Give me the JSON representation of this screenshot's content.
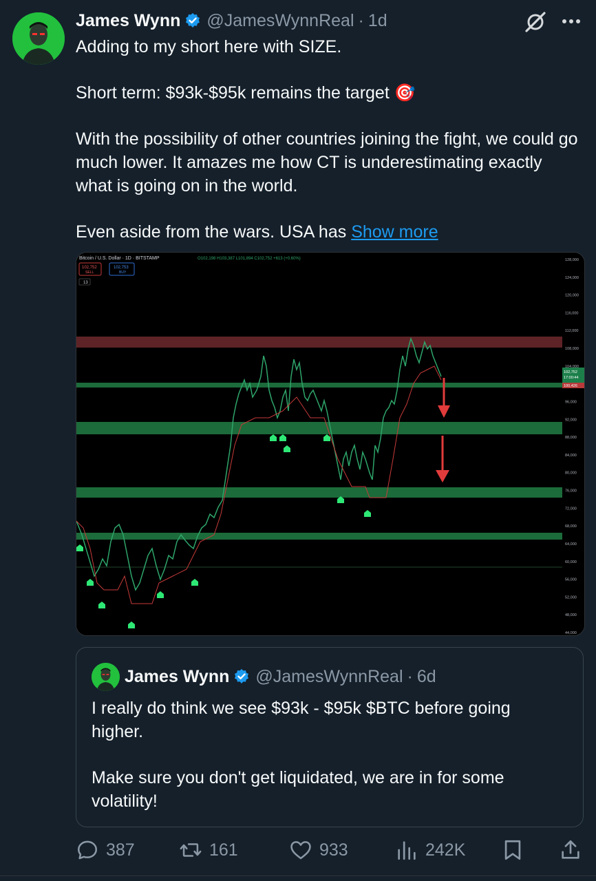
{
  "tweet": {
    "author_name": "James Wynn",
    "handle": "@JamesWynnReal",
    "separator": "·",
    "time": "1d",
    "text_lines": [
      "Adding to my short here with SIZE.",
      "Short term: $93k-$95k remains the target 🎯",
      "With the possibility of other countries joining the fight, we could go much lower. It amazes me how CT is underestimating exactly what is going on in the world.",
      "Even aside from the wars. USA has"
    ],
    "show_more": "Show more"
  },
  "chart": {
    "title": "Bitcoin / U.S. Dollar · 1D · BITSTAMP",
    "ohlc": "O102,198 H103,387 L101,894 C102,752 +613 (+0.60%)",
    "sell_price": "102,752",
    "sell_label": "SELL",
    "buy_price": "102,753",
    "buy_label": "BUY",
    "indicator_count": "13",
    "price_label_current": "102,752",
    "price_label_timer": "17:00:44",
    "price_label_red": "100,426",
    "y_ticks": [
      "128,000",
      "124,000",
      "120,000",
      "116,000",
      "112,000",
      "108,000",
      "104,000",
      "100,000",
      "96,000",
      "92,000",
      "88,000",
      "84,000",
      "80,000",
      "76,000",
      "72,000",
      "68,000",
      "64,000",
      "60,000",
      "56,000",
      "52,000",
      "48,000",
      "44,000"
    ]
  },
  "quote": {
    "author_name": "James Wynn",
    "handle": "@JamesWynnReal",
    "separator": "·",
    "time": "6d",
    "text_lines": [
      "I really do think we see $93k - $95k $BTC before going higher.",
      "Make sure you don't get liquidated, we are in for some volatility!"
    ]
  },
  "actions": {
    "replies": "387",
    "reposts": "161",
    "likes": "933",
    "views": "242K"
  },
  "colors": {
    "background": "#15202b",
    "accent": "#1d9bf0",
    "muted": "#8b98a5",
    "resistance_zone": "#5e2326",
    "support_zone": "#1c6b3a"
  }
}
